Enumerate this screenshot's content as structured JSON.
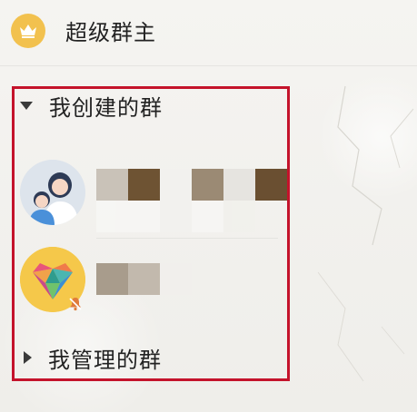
{
  "super_section": {
    "icon": "crown-icon",
    "title": "超级群主",
    "badge_color": "#f2c14e"
  },
  "groups": {
    "created": {
      "label": "我创建的群",
      "expanded": true,
      "items": [
        {
          "avatar": "family-avatar",
          "name_hidden": true
        },
        {
          "avatar": "heart-avatar",
          "name_hidden": true,
          "muted": true
        }
      ]
    },
    "managed": {
      "label": "我管理的群",
      "expanded": false
    }
  },
  "colors": {
    "highlight": "#c4132b",
    "text": "#222222",
    "arrow": "#3a3a3a"
  }
}
